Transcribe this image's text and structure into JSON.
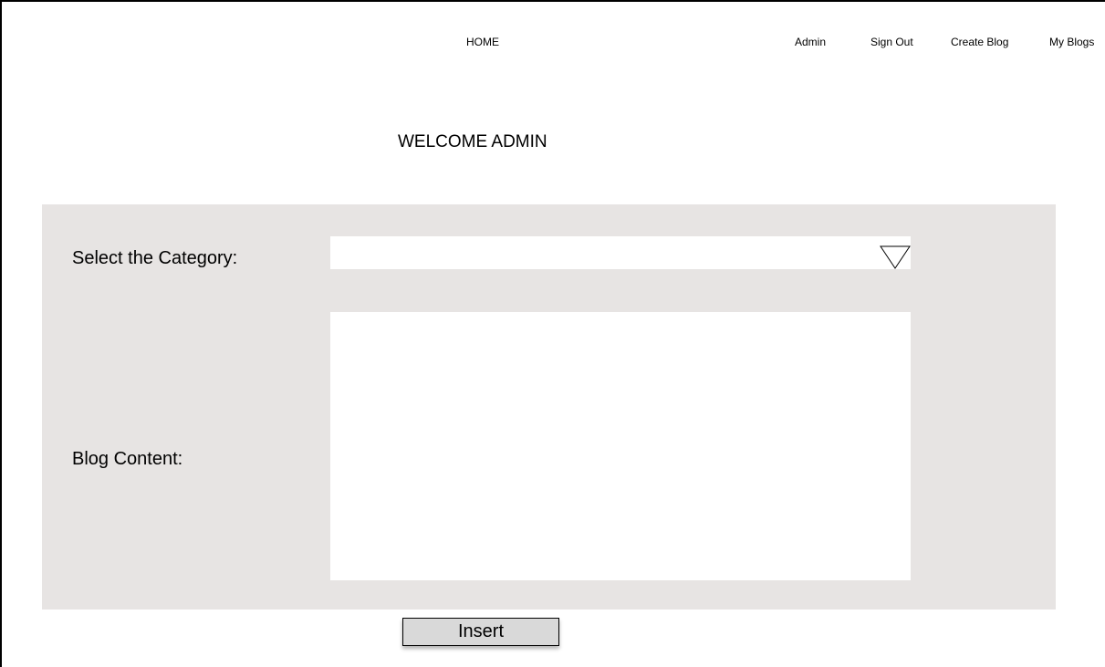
{
  "nav": {
    "home": "HOME",
    "admin": "Admin",
    "sign_out": "Sign Out",
    "create_blog": "Create Blog",
    "my_blogs": "My Blogs"
  },
  "page": {
    "welcome": "WELCOME ADMIN"
  },
  "form": {
    "category_label": "Select the Category:",
    "category_value": "",
    "dropdown_icon": "chevron-down-triangle",
    "content_label": "Blog Content:",
    "content_value": "",
    "panel_color": "#e7e4e3"
  },
  "actions": {
    "insert_label": "Insert"
  }
}
